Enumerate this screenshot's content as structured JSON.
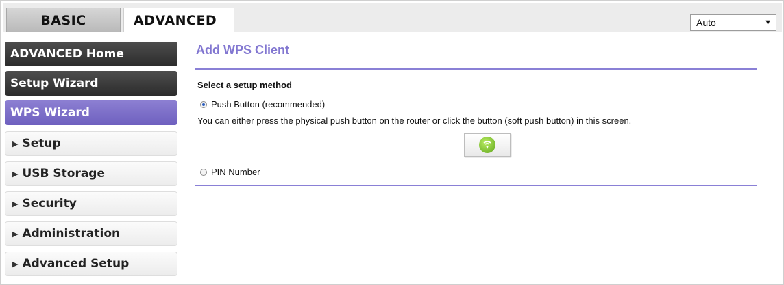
{
  "tabs": {
    "basic": "BASIC",
    "advanced": "ADVANCED"
  },
  "language_select": {
    "value": "Auto"
  },
  "sidebar": {
    "items": [
      {
        "label": "ADVANCED Home"
      },
      {
        "label": "Setup Wizard"
      },
      {
        "label": "WPS Wizard"
      },
      {
        "label": "Setup"
      },
      {
        "label": "USB Storage"
      },
      {
        "label": "Security"
      },
      {
        "label": "Administration"
      },
      {
        "label": "Advanced Setup"
      }
    ]
  },
  "main": {
    "title": "Add WPS Client",
    "section_label": "Select a setup method",
    "push_button_option": "Push Button (recommended)",
    "push_button_description": "You can either press the physical push button on the router or click the button (soft push button) in this screen.",
    "pin_option": "PIN Number"
  },
  "colors": {
    "accent": "#8277d1",
    "active_nav": "#7a6cc8",
    "dark_nav": "#3a3a3a",
    "wps_green": "#7cc72f"
  },
  "icons": {
    "wps": "wps-push-icon",
    "nav_arrow": "triangle-right-icon",
    "dropdown": "chevron-down-icon"
  }
}
